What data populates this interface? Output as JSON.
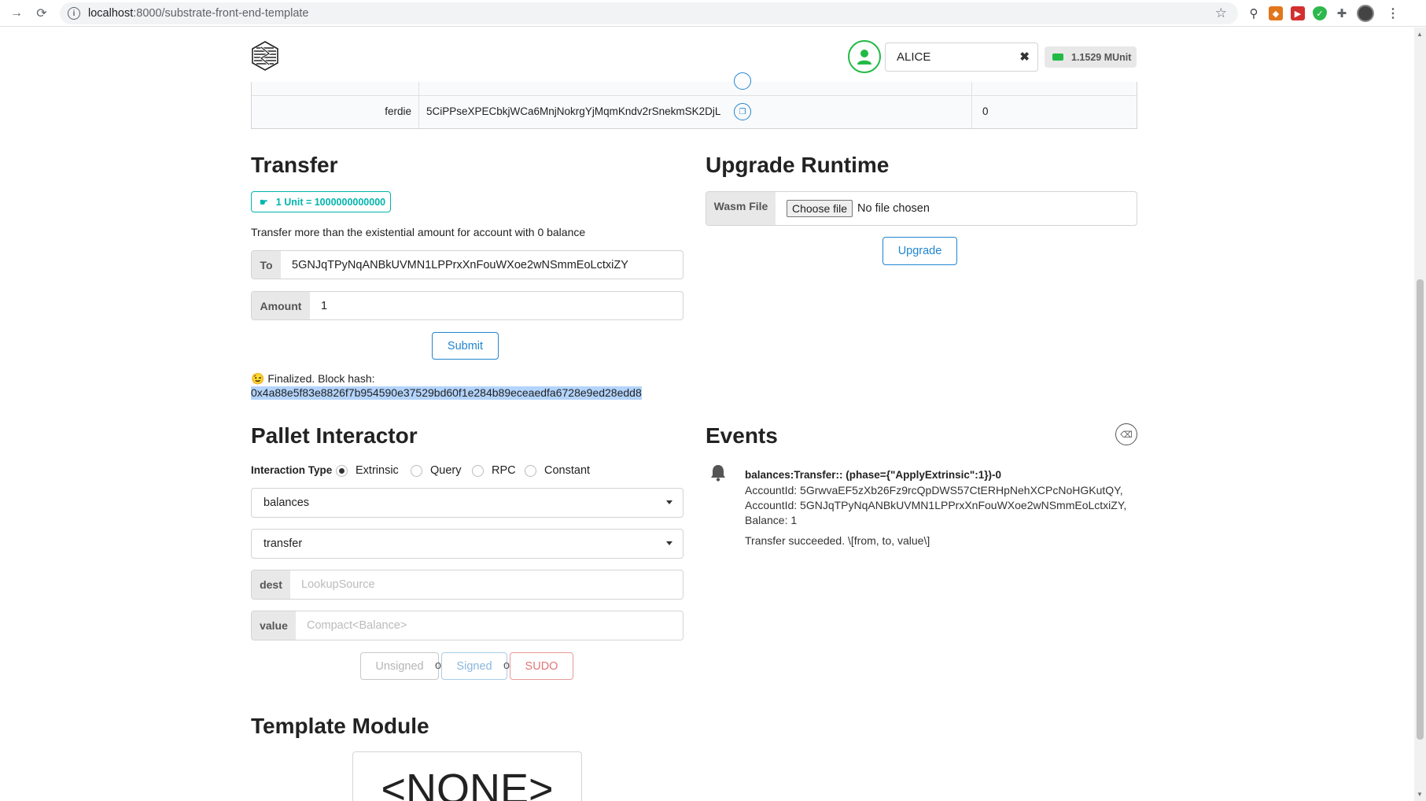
{
  "browser": {
    "url_host": "localhost",
    "url_path": ":8000/substrate-front-end-template"
  },
  "header": {
    "account_name": "ALICE",
    "clear_symbol": "✖",
    "balance": "1.1529 MUnit"
  },
  "accounts_table": {
    "row": {
      "name": "ferdie",
      "address": "5CiPPseXPECbkjWCa6MnjNokrgYjMqmKndv2rSnekmSK2DjL",
      "balance": "0"
    }
  },
  "transfer": {
    "title": "Transfer",
    "unit_label": "1 Unit = 1000000000000",
    "note": "Transfer more than the existential amount for account with 0 balance",
    "to_label": "To",
    "to_value": "5GNJqTPyNqANBkUVMN1LPPrxXnFouWXoe2wNSmmEoLctxiZY",
    "amount_label": "Amount",
    "amount_value": "1",
    "submit_label": "Submit",
    "status_emoji": "😉",
    "status_text": "Finalized. Block hash:",
    "block_hash": "0x4a88e5f83e8826f7b954590e37529bd60f1e284b89eceaedfa6728e9ed28edd8"
  },
  "upgrade": {
    "title": "Upgrade Runtime",
    "file_label": "Wasm File",
    "choose_label": "Choose file",
    "no_file": "No file chosen",
    "button_label": "Upgrade"
  },
  "pallet": {
    "title": "Pallet Interactor",
    "interaction_label": "Interaction Type",
    "types": [
      "Extrinsic",
      "Query",
      "RPC",
      "Constant"
    ],
    "selected_type": "Extrinsic",
    "pallet_value": "balances",
    "call_value": "transfer",
    "dest_label": "dest",
    "dest_placeholder": "LookupSource",
    "value_label": "value",
    "value_placeholder": "Compact<Balance>",
    "unsigned_label": "Unsigned",
    "signed_label": "Signed",
    "sudo_label": "SUDO",
    "or_text": "or"
  },
  "events": {
    "title": "Events",
    "items": [
      {
        "title": "balances:Transfer:: (phase={\"ApplyExtrinsic\":1})-0",
        "lines": [
          "AccountId: 5GrwvaEF5zXb26Fz9rcQpDWS57CtERHpNehXCPcNoHGKutQY,",
          "AccountId: 5GNJqTPyNqANBkUVMN1LPPrxXnFouWXoe2wNSmmEoLctxiZY,",
          "Balance: 1"
        ],
        "doc": "Transfer succeeded. \\[from, to, value\\]"
      }
    ]
  },
  "template_module": {
    "title": "Template Module",
    "value": "<NONE>"
  },
  "colors": {
    "accent_blue": "#2185d0",
    "teal": "#00b5ad",
    "green": "#21ba45",
    "red": "#db2828"
  }
}
